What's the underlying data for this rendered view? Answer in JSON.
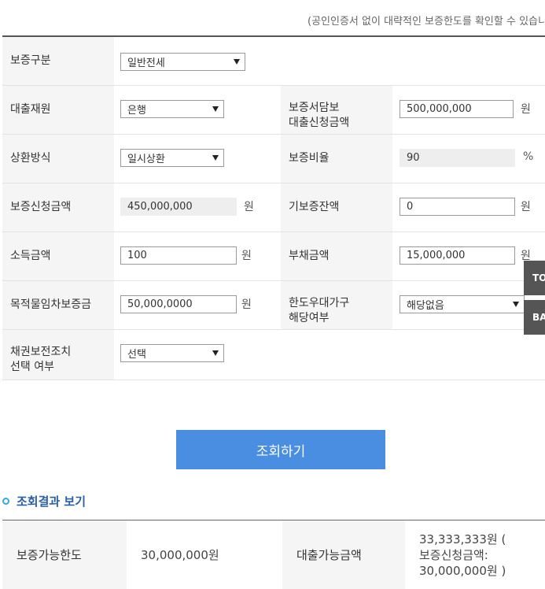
{
  "notice": "(공인인증서 없이 대략적인 보증한도를 확인할 수 있습니다)",
  "form": {
    "guarantee_type": {
      "label": "보증구분",
      "value": "일반전세"
    },
    "loan_source": {
      "label": "대출재원",
      "value": "은행"
    },
    "deposit_loan_amount": {
      "label_line1": "보증서담보",
      "label_line2": "대출신청금액",
      "value": "500,000,000",
      "unit": "원"
    },
    "repayment_method": {
      "label": "상환방식",
      "value": "일시상환"
    },
    "guarantee_ratio": {
      "label": "보증비율",
      "value": "90",
      "unit": "%"
    },
    "guarantee_request_amount": {
      "label": "보증신청금액",
      "value": "450,000,000",
      "unit": "원"
    },
    "existing_guarantee_balance": {
      "label": "기보증잔액",
      "value": "0",
      "unit": "원"
    },
    "income_amount": {
      "label": "소득금액",
      "value": "100",
      "unit": "원"
    },
    "debt_amount": {
      "label": "부채금액",
      "value": "15,000,000",
      "unit": "원"
    },
    "lease_deposit": {
      "label": "목적물임차보증금",
      "value": "50,000,0000",
      "unit": "원"
    },
    "priority_household": {
      "label_line1": "한도우대가구",
      "label_line2": "해당여부",
      "value": "해당없음"
    },
    "bond_preservation": {
      "label_line1": "채권보전조치",
      "label_line2": "선택 여부",
      "value": "선택"
    }
  },
  "side_buttons": {
    "top": "TOP",
    "back": "BACK"
  },
  "search_button": "조회하기",
  "result": {
    "title": "조회결과 보기",
    "limit_label": "보증가능한도",
    "limit_value": "30,000,000원",
    "loan_label": "대출가능금액",
    "loan_line1": "33,333,333원 (",
    "loan_line2": "보증신청금액:",
    "loan_line3": "30,000,000원 )"
  },
  "colors": {
    "button": "#4a8ee1",
    "heading": "#2a5ea8",
    "bullet": "#33aadd",
    "side_button": "#555555"
  }
}
